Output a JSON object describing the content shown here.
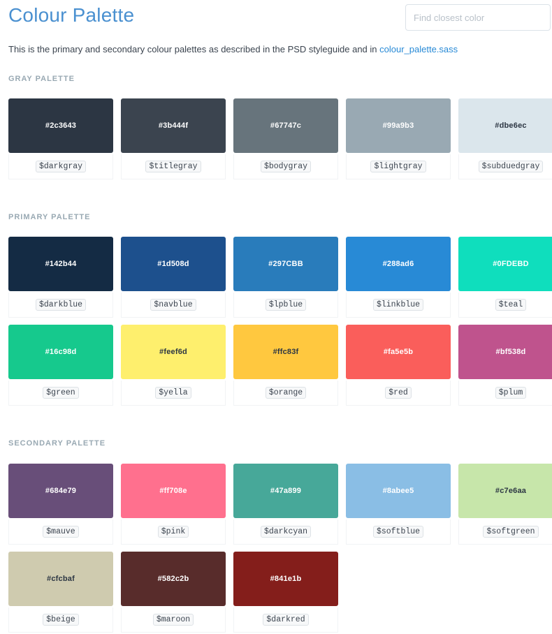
{
  "page": {
    "title": "Colour Palette",
    "search_placeholder": "Find closest color",
    "intro_text": "This is the primary and secondary colour palettes as described in the PSD styleguide and in ",
    "intro_link": "colour_palette.sass"
  },
  "sections": [
    {
      "heading": "GRAY PALETTE",
      "colors": [
        {
          "hex": "#2c3643",
          "var": "$darkgray",
          "text": "light"
        },
        {
          "hex": "#3b444f",
          "var": "$titlegray",
          "text": "light"
        },
        {
          "hex": "#67747c",
          "var": "$bodygray",
          "text": "light"
        },
        {
          "hex": "#99a9b3",
          "var": "$lightgray",
          "text": "light"
        },
        {
          "hex": "#dbe6ec",
          "var": "$subduedgray",
          "text": "dark"
        }
      ]
    },
    {
      "heading": "PRIMARY PALETTE",
      "colors": [
        {
          "hex": "#142b44",
          "var": "$darkblue",
          "text": "light"
        },
        {
          "hex": "#1d508d",
          "var": "$navblue",
          "text": "light"
        },
        {
          "hex": "#297CBB",
          "var": "$lpblue",
          "text": "light"
        },
        {
          "hex": "#288ad6",
          "var": "$linkblue",
          "text": "light"
        },
        {
          "hex": "#0FDEBD",
          "var": "$teal",
          "text": "light"
        },
        {
          "hex": "#16c98d",
          "var": "$green",
          "text": "light"
        },
        {
          "hex": "#feef6d",
          "var": "$yella",
          "text": "dark"
        },
        {
          "hex": "#ffc83f",
          "var": "$orange",
          "text": "dark"
        },
        {
          "hex": "#fa5e5b",
          "var": "$red",
          "text": "light"
        },
        {
          "hex": "#bf538d",
          "var": "$plum",
          "text": "light"
        }
      ]
    },
    {
      "heading": "SECONDARY PALETTE",
      "colors": [
        {
          "hex": "#684e79",
          "var": "$mauve",
          "text": "light"
        },
        {
          "hex": "#ff708e",
          "var": "$pink",
          "text": "light"
        },
        {
          "hex": "#47a899",
          "var": "$darkcyan",
          "text": "light"
        },
        {
          "hex": "#8abee5",
          "var": "$softblue",
          "text": "light"
        },
        {
          "hex": "#c7e6aa",
          "var": "$softgreen",
          "text": "dark"
        },
        {
          "hex": "#cfcbaf",
          "var": "$beige",
          "text": "dark"
        },
        {
          "hex": "#582c2b",
          "var": "$maroon",
          "text": "light"
        },
        {
          "hex": "#841e1b",
          "var": "$darkred",
          "text": "light"
        }
      ]
    }
  ]
}
